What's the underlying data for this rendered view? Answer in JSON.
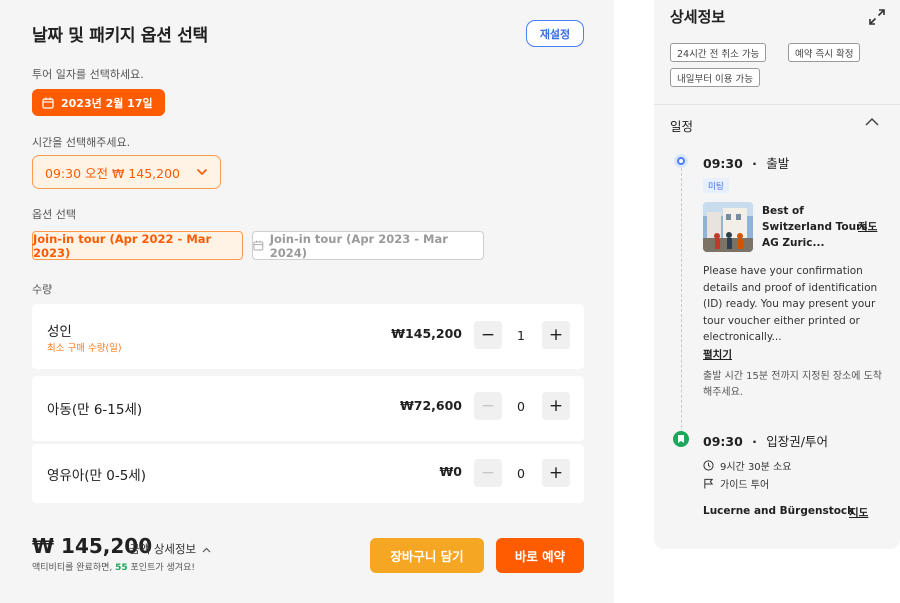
{
  "left": {
    "title": "날짜 및 패키지 옵션 선택",
    "reset_label": "재설정",
    "date_prompt": "투어 일자를 선택하세요.",
    "selected_date": "2023년 2월 17일",
    "time_prompt": "시간을 선택해주세요.",
    "selected_time": "09:30 오전 ₩ 145,200",
    "option_prompt": "옵션 선택",
    "options": [
      {
        "label": "Join-in tour (Apr 2022 - Mar 2023)",
        "selected": true
      },
      {
        "label": "Join-in tour (Apr 2023 - Mar 2024)",
        "selected": false
      }
    ],
    "quantity_prompt": "수량",
    "quantities": [
      {
        "name": "성인",
        "sub": "최소 구매 수량(일)",
        "price": "₩145,200",
        "count": "1"
      },
      {
        "name": "아동(만 6-15세)",
        "sub": "",
        "price": "₩72,600",
        "count": "0"
      },
      {
        "name": "영유아(만 0-5세)",
        "sub": "",
        "price": "₩0",
        "count": "0"
      }
    ],
    "total": "₩ 145,200",
    "detail_label": "금액 상세정보",
    "points_prefix": "액티비티를 완료하면,",
    "points_value": "55",
    "points_suffix": "포인트가 생겨요!",
    "cart_label": "장바구니 담기",
    "book_label": "바로 예약"
  },
  "right": {
    "title": "상세정보",
    "tags": [
      "24시간 전 취소 가능",
      "예약 즉시 확정",
      "내일부터 이용 가능"
    ],
    "schedule_title": "일정",
    "events": [
      {
        "time": "09:30",
        "sep": "·",
        "title": "출발",
        "badge": "미팅",
        "place": "Best of Switzerland Tours AG Zuric...",
        "map": "지도",
        "description": "Please have your confirmation details and proof of identification (ID) ready. You may present your tour voucher either printed or electronically...",
        "more": "펼치기",
        "note": "출발 시간 15분 전까지 지정된 장소에 도착해주세요."
      },
      {
        "time": "09:30",
        "sep": "·",
        "title": "입장권/투어",
        "duration": "9시간 30분 소요",
        "guide": "가이드 투어",
        "place": "Lucerne and Bürgenstock",
        "map": "지도"
      }
    ]
  },
  "colors": {
    "accent": "#ff5b00",
    "cart": "#f5a623",
    "blue": "#4a7ff2",
    "green": "#1ea65a"
  }
}
